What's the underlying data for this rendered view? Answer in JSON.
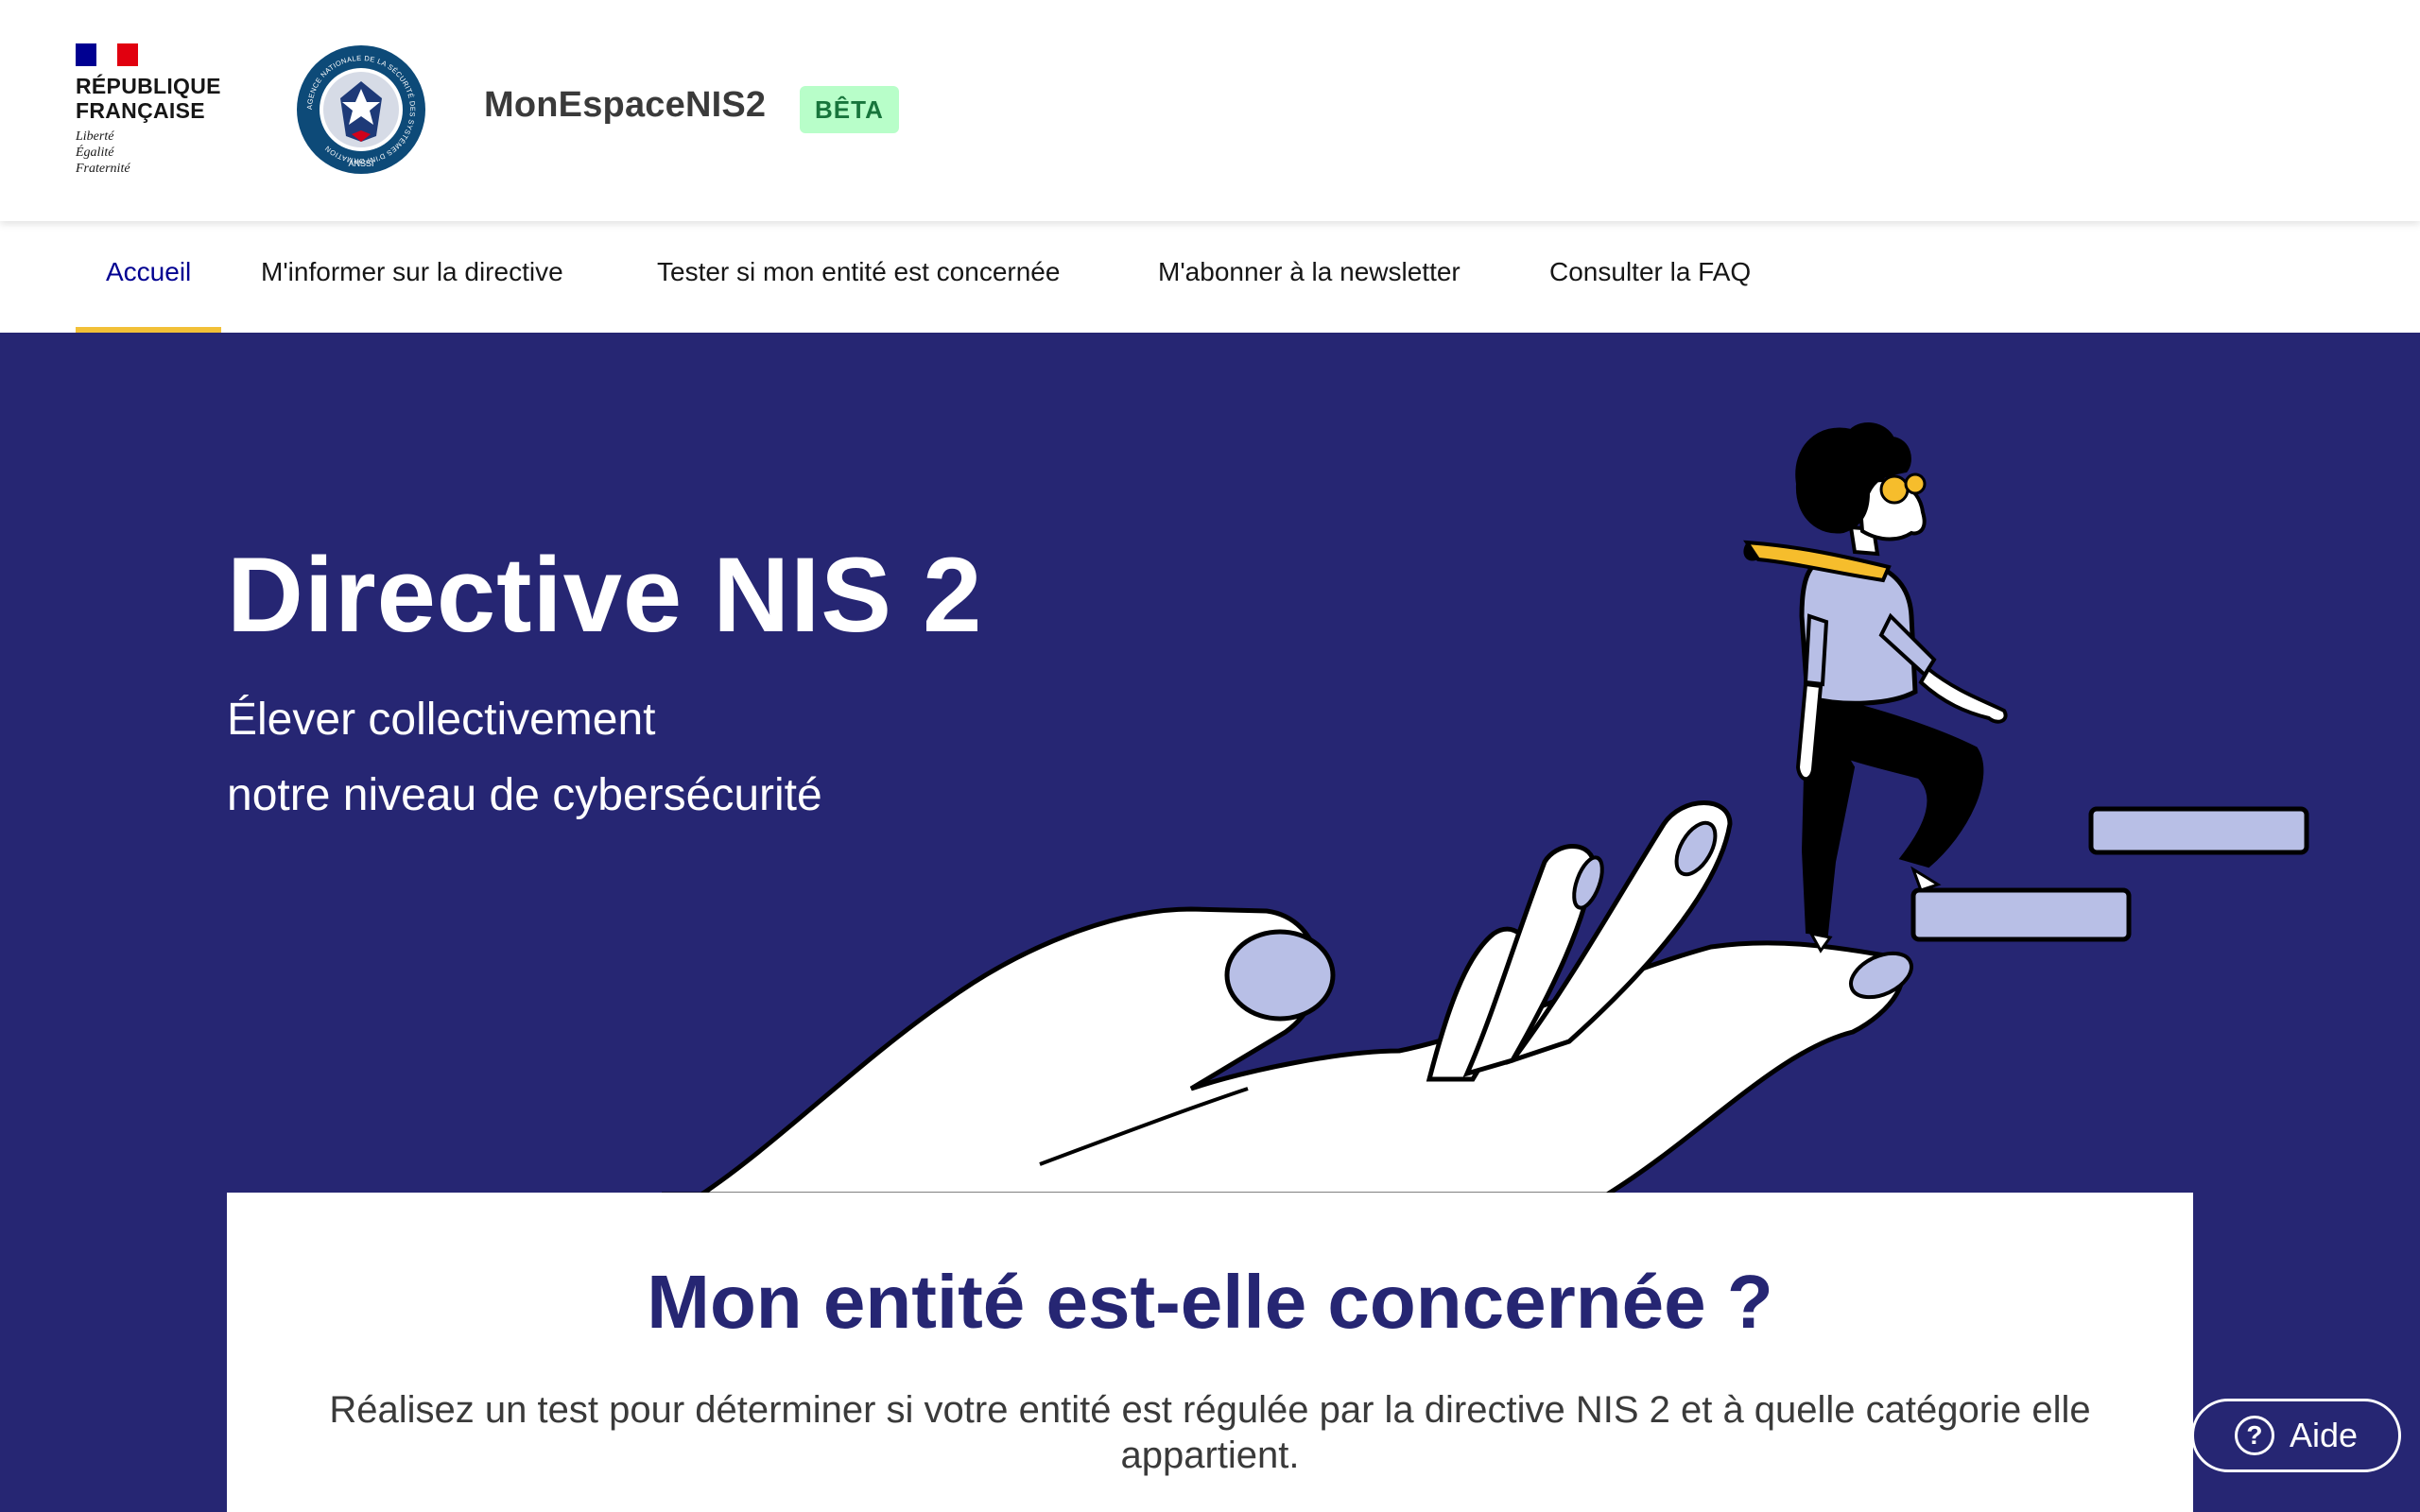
{
  "header": {
    "republique_line1": "RÉPUBLIQUE",
    "republique_line2": "FRANÇAISE",
    "motto": [
      "Liberté",
      "Égalité",
      "Fraternité"
    ],
    "service_name": "MonEspaceNIS2",
    "badge": "BÊTA",
    "anssi_ring_text": "AGENCE NATIONALE DE LA SÉCURITÉ DES SYSTÈMES D'INFORMATION",
    "anssi_short": "ANSSI"
  },
  "nav": {
    "items": [
      {
        "label": "Accueil",
        "active": true
      },
      {
        "label": "M'informer sur la directive",
        "active": false
      },
      {
        "label": "Tester si mon entité est concernée",
        "active": false
      },
      {
        "label": "M'abonner à la newsletter",
        "active": false
      },
      {
        "label": "Consulter la FAQ",
        "active": false
      }
    ]
  },
  "hero": {
    "title": "Directive NIS 2",
    "subtitle_line1": "Élever collectivement",
    "subtitle_line2": "notre niveau de cybersécurité"
  },
  "card": {
    "title": "Mon entité est-elle concernée ?",
    "text": "Réalisez un test pour déterminer si votre entité est régulée par la directive NIS 2 et à quelle catégorie elle appartient."
  },
  "help": {
    "label": "Aide",
    "icon": "question-circle-icon"
  },
  "colors": {
    "hero_bg": "#262673",
    "brand_blue": "#000091",
    "nav_indicator": "#f2c037",
    "badge_bg": "#b8fec9",
    "badge_text": "#18753c",
    "illustration_lavender": "#b8bfe6",
    "illustration_yellow": "#f6bd2c"
  }
}
